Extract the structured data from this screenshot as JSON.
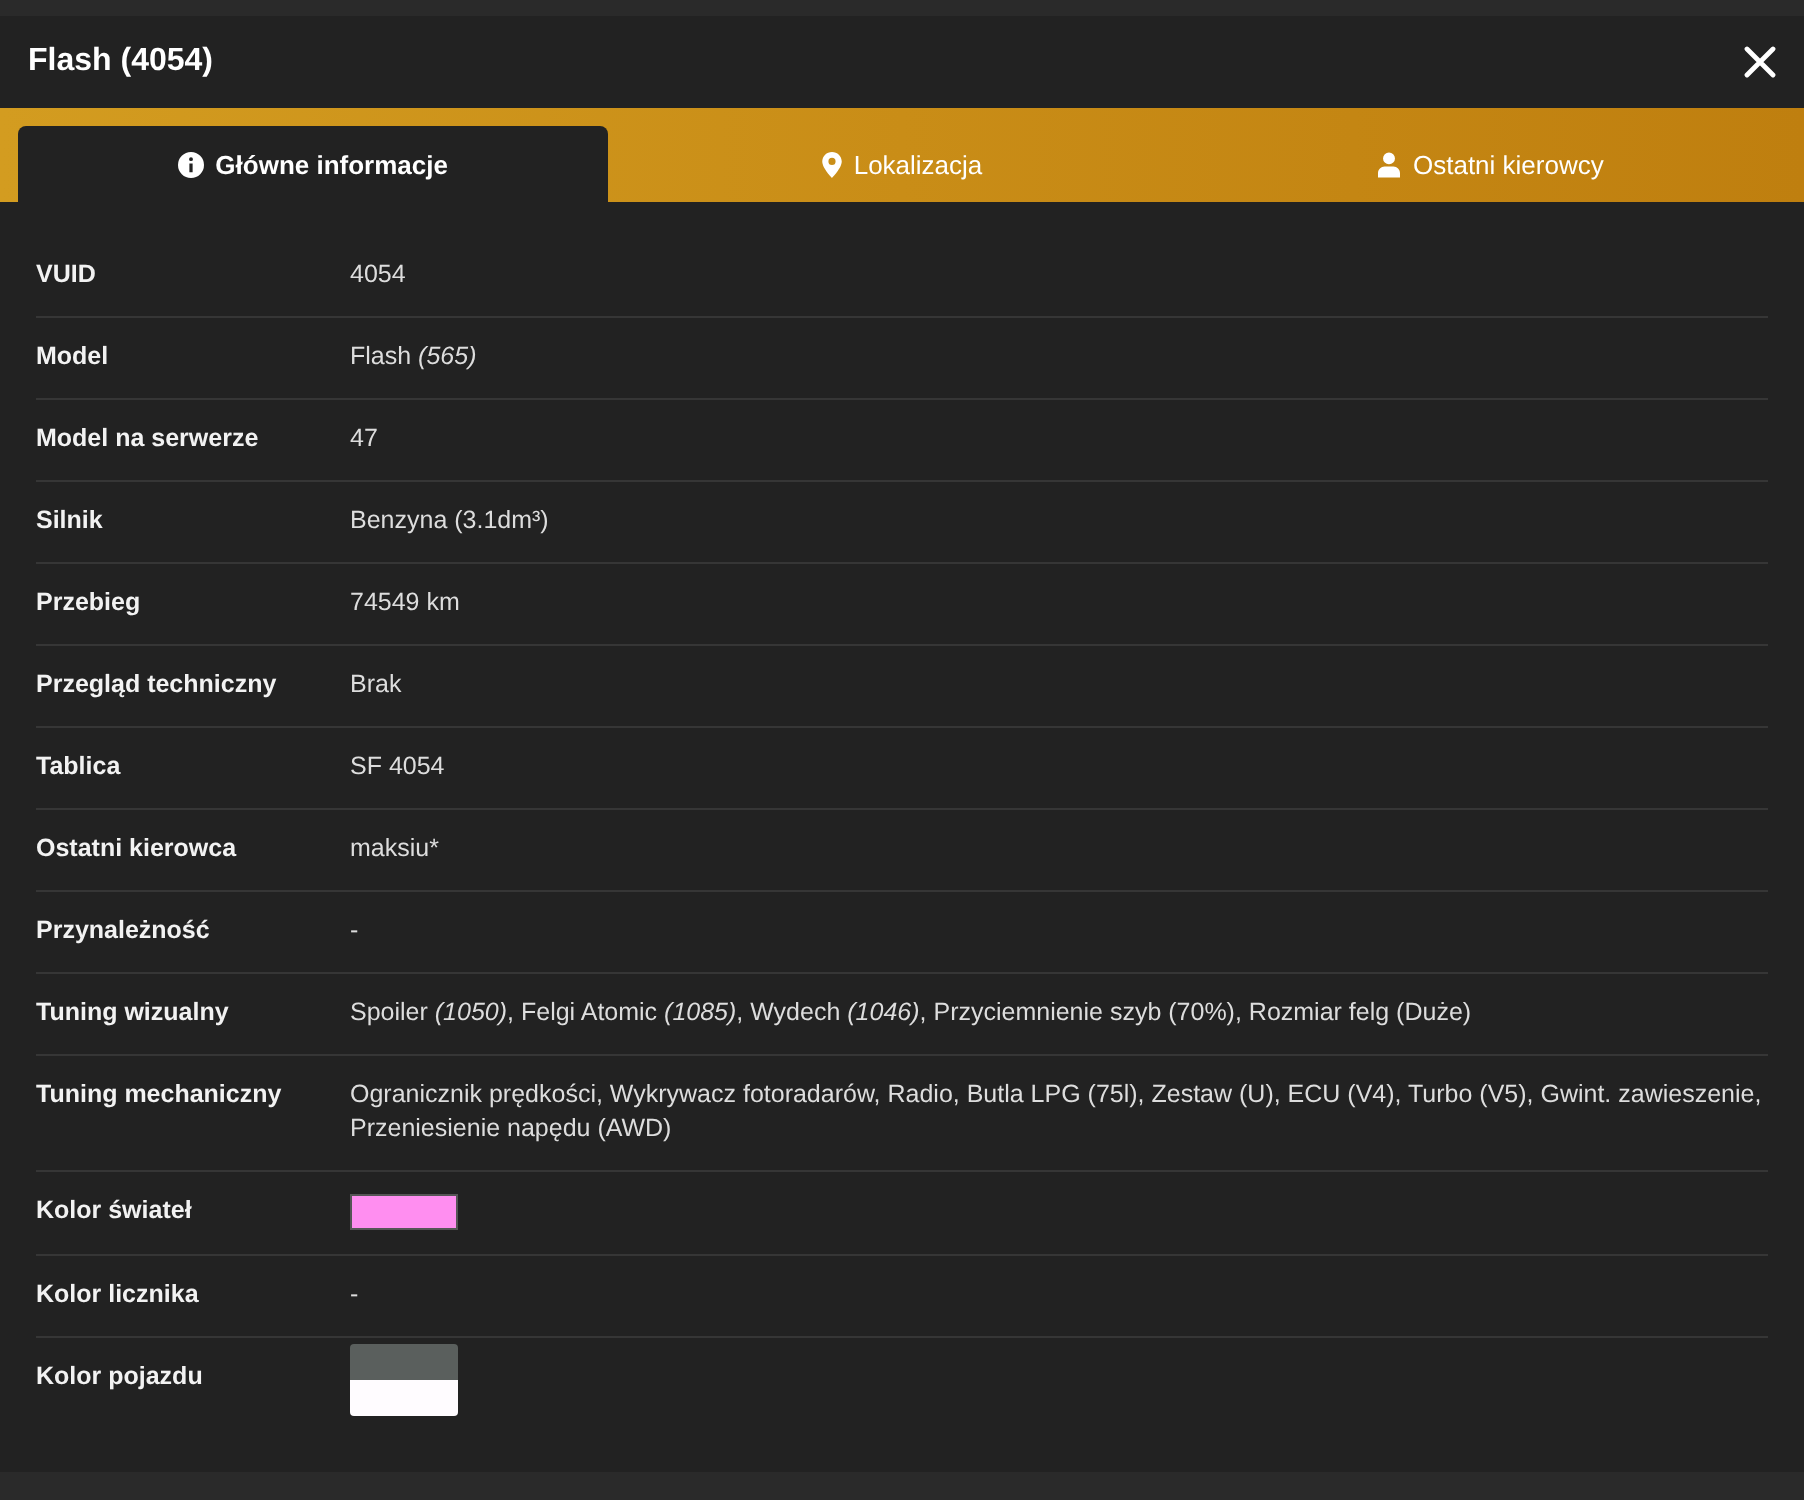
{
  "window": {
    "title": "Flash (4054)"
  },
  "tabs": [
    {
      "label": "Główne informacje",
      "selected": true
    },
    {
      "label": "Lokalizacja",
      "selected": false
    },
    {
      "label": "Ostatni kierowcy",
      "selected": false
    }
  ],
  "rows": [
    {
      "label": "VUID",
      "kind": "text",
      "value": "4054"
    },
    {
      "label": "Model",
      "kind": "text",
      "value": "Flash *(565)*"
    },
    {
      "label": "Model na serwerze",
      "kind": "text",
      "value": "47"
    },
    {
      "label": "Silnik",
      "kind": "text",
      "value": "Benzyna (3.1dm³)"
    },
    {
      "label": "Przebieg",
      "kind": "text",
      "value": "74549 km"
    },
    {
      "label": "Przegląd techniczny",
      "kind": "text",
      "value": "Brak"
    },
    {
      "label": "Tablica",
      "kind": "text",
      "value": "SF 4054"
    },
    {
      "label": "Ostatni kierowca",
      "kind": "text",
      "value": "maksiu*"
    },
    {
      "label": "Przynależność",
      "kind": "text",
      "value": "-"
    },
    {
      "label": "Tuning wizualny",
      "kind": "text",
      "value": "Spoiler *(1050)*, Felgi Atomic *(1085)*, Wydech *(1046)*, Przyciemnienie szyb (70%), Rozmiar felg (Duże)"
    },
    {
      "label": "Tuning mechaniczny",
      "kind": "text",
      "value": "Ogranicznik prędkości, Wykrywacz fotoradarów, Radio, Butla LPG (75l), Zestaw (U), ECU (V4), Turbo (V5), Gwint. zawieszenie, Przeniesienie napędu (AWD)"
    },
    {
      "label": "Kolor świateł",
      "kind": "color",
      "color": "#ff8ef0"
    },
    {
      "label": "Kolor licznika",
      "kind": "text",
      "value": "-"
    },
    {
      "label": "Kolor pojazdu",
      "kind": "colors",
      "colors": [
        {
          "color": "#5a5f5d"
        },
        {
          "color": "#fffcff"
        }
      ]
    }
  ]
}
